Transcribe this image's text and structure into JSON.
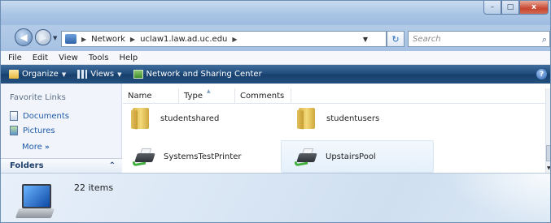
{
  "window": {
    "caption": {
      "minimize": "–",
      "maximize": "□",
      "close": "x"
    }
  },
  "address": {
    "segments": [
      "Network",
      "uclaw1.law.ad.uc.edu"
    ],
    "search_placeholder": "Search"
  },
  "menu": [
    "File",
    "Edit",
    "View",
    "Tools",
    "Help"
  ],
  "commands": {
    "organize": "Organize",
    "views": "Views",
    "network_sharing": "Network and Sharing Center"
  },
  "nav": {
    "favorites_header": "Favorite Links",
    "favorites": [
      "Documents",
      "Pictures"
    ],
    "more": "More",
    "more_glyph": "»",
    "folders": "Folders"
  },
  "columns": {
    "name": "Name",
    "type": "Type",
    "comments": "Comments"
  },
  "items": [
    {
      "label": "studentshared",
      "icon": "folder-icon"
    },
    {
      "label": "studentusers",
      "icon": "folder-icon"
    },
    {
      "label": "SystemsTestPrinter",
      "icon": "printer-icon"
    },
    {
      "label": "UpstairsPool",
      "icon": "printer-icon"
    }
  ],
  "details": {
    "count": "22 items"
  },
  "colors": {
    "command_bar": "#1e4a7a",
    "link": "#1e5aa8",
    "selection": "#e5f0fb"
  }
}
